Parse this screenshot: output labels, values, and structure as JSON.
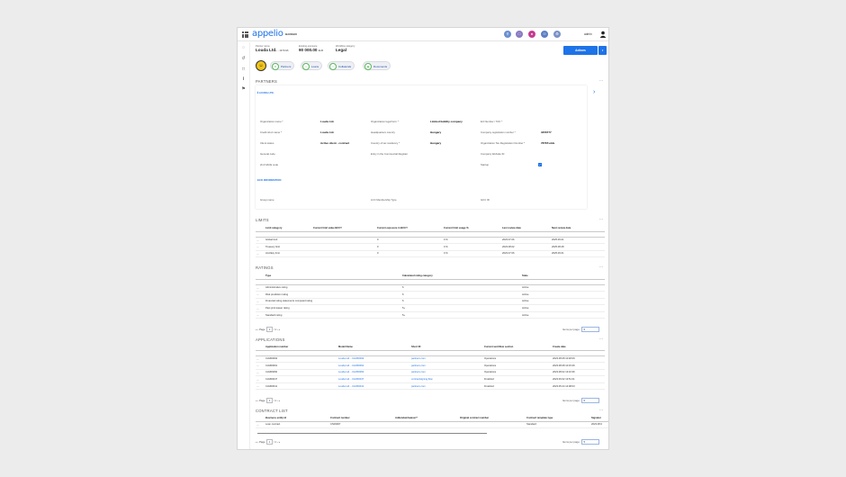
{
  "app": {
    "logo": "appelio",
    "tenant": "BAREBO",
    "user": "admin"
  },
  "sidenav": [
    {
      "icon": "chat-icon",
      "glyph": "◌"
    },
    {
      "icon": "history-icon",
      "glyph": "↺"
    },
    {
      "icon": "document-icon",
      "glyph": "□"
    },
    {
      "icon": "info-icon",
      "glyph": "i"
    },
    {
      "icon": "flag-icon",
      "glyph": "⚑"
    }
  ],
  "header": {
    "partner_name_label": "Partner name",
    "partner_name": "Louda Ltd.",
    "partner_id": "- 1373416",
    "existing_exposure_label": "Existing exposure",
    "existing_exposure": "90 000.00",
    "currency": "EUR",
    "workflow_category_label": "Workflow category",
    "workflow_category": "Legal",
    "actions_label": "Actions"
  },
  "pills": [
    "Partners",
    "Loans",
    "Collaterals",
    "Documents"
  ],
  "partners": {
    "title": "PARTNERS",
    "link": "ℹ LOUDA LTD.",
    "fields": [
      {
        "label": "Organization name",
        "req": true,
        "value": "Louda Ltd."
      },
      {
        "label": "Organization legal form",
        "req": true,
        "value": "Limited liability company"
      },
      {
        "label": "EU Number / TAX",
        "req": true,
        "value": ""
      },
      {
        "label": "Credit short name",
        "req": true,
        "value": "Louda Ltd."
      },
      {
        "label": "Headquarters country",
        "req": false,
        "value": "Hungary"
      },
      {
        "label": "Company registration number",
        "req": true,
        "value": "3456777"
      },
      {
        "label": "Client status",
        "req": false,
        "value": "Active client - contract"
      },
      {
        "label": "Country of tax residency",
        "req": true,
        "value": "Hungary"
      },
      {
        "label": "Organization Tax Registration Number",
        "req": true,
        "value": "78767sdds"
      },
      {
        "label": "General code",
        "req": false,
        "value": ""
      },
      {
        "label": "Entry in the Commercial Register",
        "req": false,
        "value": ""
      },
      {
        "label": "Company Website ID",
        "req": false,
        "value": ""
      },
      {
        "label": "2nd NACE code",
        "req": false,
        "value": ""
      },
      {
        "label": "",
        "req": false,
        "value": ""
      },
      {
        "label": "Startup",
        "req": false,
        "value": ""
      }
    ],
    "eco_link": "ECO INFORMATION",
    "eco_fields": [
      {
        "label": "Group name",
        "value": ""
      },
      {
        "label": "LCC Membership Type",
        "value": ""
      },
      {
        "label": "GCC ID",
        "value": ""
      }
    ]
  },
  "limits": {
    "title": "LIMITS",
    "columns": [
      "Limit category",
      "Current limit value BCCY",
      "Current exposure in BCCY",
      "Current limit usage %",
      "Last review date",
      "Next review date"
    ],
    "rows": [
      [
        "Global limit",
        "",
        "0",
        "0 %",
        "2023.07.06",
        "2025.06.01"
      ],
      [
        "Treasury limit",
        "",
        "0",
        "0 %",
        "2023.08.02",
        "2025.08.28"
      ],
      [
        "Ancillary limit",
        "",
        "0",
        "0 %",
        "2023.07.06",
        "2025.06.01"
      ]
    ]
  },
  "ratings": {
    "title": "RATINGS",
    "columns": [
      "Type",
      "Calculated rating category",
      "State"
    ],
    "rows": [
      [
        "Administrative rating",
        "6",
        "Active"
      ],
      [
        "Risk prediction rating",
        "6",
        "Active"
      ],
      [
        "Financial rating statements computed rating",
        "6",
        "Active"
      ],
      [
        "Past joint leaser rating",
        "5+",
        "Active"
      ],
      [
        "Standard rating",
        "5+",
        "Active"
      ]
    ],
    "pager": {
      "page_label": "Page",
      "page": "1",
      "of": "/ 1",
      "items_label": "Items per page:",
      "items": "5"
    }
  },
  "applications": {
    "title": "APPLICATIONS",
    "columns": [
      "Application number",
      "Model Name",
      "Short ID",
      "Current workflow section",
      "Create date"
    ],
    "rows": [
      [
        "CLM00092",
        "Louda Ltd. - CLM00092",
        "partners.com",
        "Operations",
        "2023.08.08 10:48:09"
      ],
      [
        "CLM00091",
        "Louda Ltd. - CLM00091",
        "partners.com",
        "Operations",
        "2023.08.08 10:15:26"
      ],
      [
        "CLM00060",
        "Louda Ltd. - CLM00060",
        "partners.com",
        "Operations",
        "2023.08.02 13:16:36"
      ],
      [
        "CLM00047",
        "Louda Ltd. - CLM00047",
        "contractsigning.flow",
        "Finalized",
        "2023.06.02 13:51:41"
      ],
      [
        "CLM00041",
        "Louda Ltd. - CLM00041",
        "partners.com",
        "Finalized",
        "2023.05.24 14:08:03"
      ]
    ],
    "pager": {
      "page_label": "Page",
      "page": "1",
      "of": "/ 1",
      "items_label": "Items per page:",
      "items": "5"
    }
  },
  "contracts": {
    "title": "CONTRACT LIST",
    "columns": [
      "Business entity Id",
      "Contract number",
      "Addendum/waiver?",
      "Original contract number",
      "Contract template type",
      "Signatur"
    ],
    "rows": [
      [
        "Loan contract",
        "CN03007",
        "",
        "",
        "Standard",
        "2023.08.0"
      ]
    ],
    "pager": {
      "page_label": "Page",
      "page": "1",
      "of": "/ 1",
      "items_label": "Items per page:",
      "items": "5"
    }
  },
  "colors": {
    "accent": "#1d73e8",
    "type_badge": "#f0c419"
  }
}
